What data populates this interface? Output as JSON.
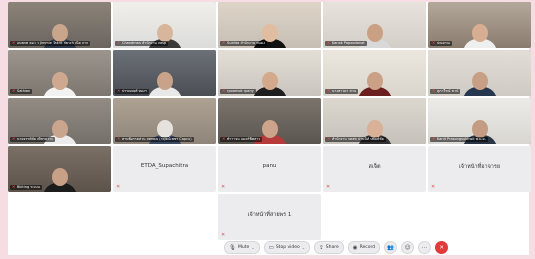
{
  "tiles": [
    {
      "kind": "video",
      "label": "อนพกท คอว ว Jimmie Takrit Yanch เน็ต จาก",
      "bg": "#6b6560",
      "wall": "#8c8378",
      "skin": "#c9a58b",
      "shirt": "#2f3a4a"
    },
    {
      "kind": "video",
      "label": "Chandman สำนักงาน vasp",
      "bg": "#dcdcdc",
      "wall": "#f0efe9",
      "skin": "#d7b69b",
      "shirt": "#3a3a3a"
    },
    {
      "kind": "video",
      "label": "Sukitta สำนักงาน หนดง",
      "bg": "#c7bfb4",
      "wall": "#ddd4c7",
      "skin": "#e0bca0",
      "shirt": "#111111"
    },
    {
      "kind": "video",
      "label": "Kanok Papoodanat",
      "bg": "#d3cfc8",
      "wall": "#e7e3dc",
      "skin": "#caa085",
      "shirt": "#d9d9d9"
    },
    {
      "kind": "video",
      "label": "ปณยาณ",
      "bg": "#8a7d70",
      "wall": "#b3a89a",
      "skin": "#d8ae93",
      "shirt": "#efefef"
    },
    {
      "kind": "video",
      "label": "Sathian",
      "bg": "#7d7770",
      "wall": "#9b958d",
      "skin": "#cfa98f",
      "shirt": "#f2f2f2"
    },
    {
      "kind": "video",
      "label": "ปรรณพงศ์ ทองฯ",
      "bg": "#4b4f55",
      "wall": "#6c7077",
      "skin": "#c8a38a",
      "shirt": "#e8e8e8"
    },
    {
      "kind": "video",
      "label": "rpoamok rpany",
      "bg": "#c9c4bd",
      "wall": "#e3ded6",
      "skin": "#d2a98b",
      "shirt": "#1f1f1f"
    },
    {
      "kind": "video",
      "label": "นางสาวดา สวน",
      "bg": "#dad5cd",
      "wall": "#ebe6de",
      "skin": "#caa086",
      "shirt": "#6b1f1f"
    },
    {
      "kind": "video",
      "label": "สุภาวีรณ์ ชาน์",
      "bg": "#cfcac3",
      "wall": "#e2ddd6",
      "skin": "#c79f85",
      "shirt": "#26364e"
    },
    {
      "kind": "video",
      "label": "นายจรรค์ชัย เพ็ชรสว่าง",
      "bg": "#75706a",
      "wall": "#928c84",
      "skin": "#caa58e",
      "shirt": "#ececec"
    },
    {
      "kind": "video",
      "label": "สานพ้อรรคส่วน สคทคน (กฤษณ์เพชร Capcu)",
      "bg": "#8f857a",
      "wall": "#ada293",
      "skin": "#e5e1dc",
      "shirt": "#3b4b63"
    },
    {
      "kind": "video",
      "label": "ทำาาจน แมคร์พิศสาว",
      "bg": "#5b5650",
      "wall": "#7a746c",
      "skin": "#cca48b",
      "shirt": "#b63a3a"
    },
    {
      "kind": "video",
      "label": "สำนักงาน กคสท ปานนิ์ห์ ปพัมห์ชัย",
      "bg": "#c6c1ba",
      "wall": "#dcd7cf",
      "skin": "#d8b197",
      "shirt": "#333333"
    },
    {
      "kind": "video",
      "label": "Kanit Prasongsukhwit พ.ม.ย.",
      "bg": "#d9d6d1",
      "wall": "#ecebe7",
      "skin": "#c49c83",
      "shirt": "#2a3546"
    },
    {
      "kind": "video",
      "label": "Bkiting ระเบน",
      "bg": "#5c534b",
      "wall": "#7b7066",
      "skin": "#c8a087",
      "shirt": "#1c1c1c"
    },
    {
      "kind": "blank",
      "label": "ETDA_Supachitra"
    },
    {
      "kind": "blank",
      "label": "panu"
    },
    {
      "kind": "blank",
      "label": "สเจ็ต"
    },
    {
      "kind": "blank",
      "label": "เจ้าหน้าที่อาจารย"
    },
    {
      "kind": "empty"
    },
    {
      "kind": "empty"
    },
    {
      "kind": "blank",
      "label": "เจ้าหน้าที่สายพร 1"
    }
  ],
  "toolbar": {
    "mute_label": "Mute",
    "stop_video_label": "Stop video",
    "share_label": "Share",
    "record_label": "Record"
  }
}
